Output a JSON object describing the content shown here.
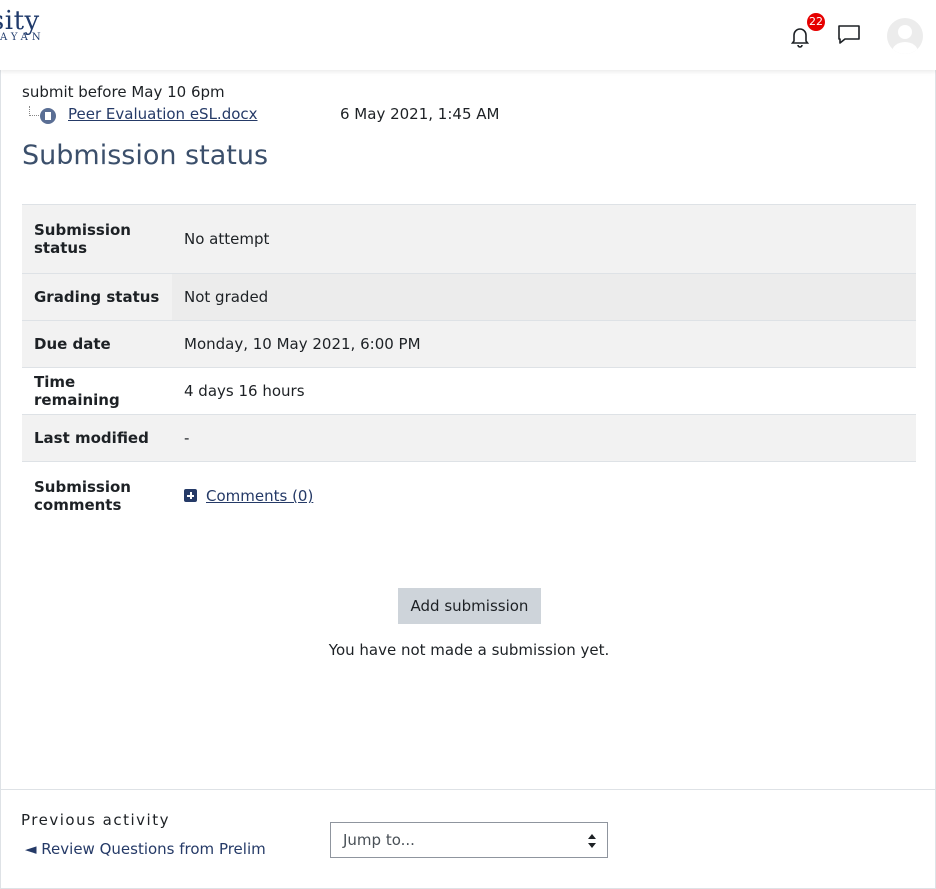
{
  "header": {
    "logo_text": "rsity",
    "logo_subtext": "AYAN",
    "notification_count": "22"
  },
  "intro": {
    "text": "submit before May 10 6pm",
    "file_name": "Peer Evaluation eSL.docx",
    "file_date": "6 May 2021, 1:45 AM"
  },
  "status": {
    "title": "Submission status",
    "rows": [
      {
        "label": "Submission status",
        "value": "No attempt"
      },
      {
        "label": "Grading status",
        "value": "Not graded"
      },
      {
        "label": "Due date",
        "value": "Monday, 10 May 2021, 6:00 PM"
      },
      {
        "label": "Time remaining",
        "value": "4 days 16 hours"
      },
      {
        "label": "Last modified",
        "value": "-"
      },
      {
        "label": "Submission comments",
        "value": "Comments (0)"
      }
    ]
  },
  "actions": {
    "add_submission": "Add submission",
    "no_submission_msg": "You have not made a submission yet."
  },
  "footer": {
    "previous_label": "Previous activity",
    "previous_link": "◄ Review Questions from Prelim",
    "jump_placeholder": "Jump to..."
  }
}
